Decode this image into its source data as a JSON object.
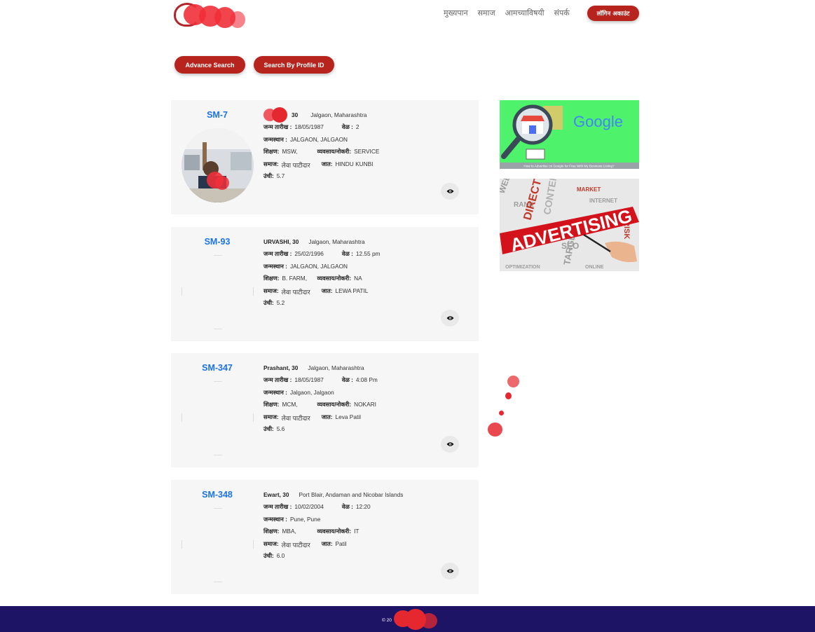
{
  "header": {
    "nav": [
      "मुख्यपान",
      "समाज",
      "आमच्याविषयी",
      "संपर्क"
    ],
    "login_label": "लॉगिन अकाउंट"
  },
  "search": {
    "advance_label": "Advance Search",
    "by_id_label": "Search By Profile ID"
  },
  "labels": {
    "dob": "जन्म तारीख :",
    "time": "वेळ :",
    "birthplace": "जन्मस्थान :",
    "education": "शिक्षण:",
    "occupation": "व्यवसाय/नोकरी:",
    "community": "समाज:",
    "caste": "जात:",
    "height": "उंची:"
  },
  "profiles": [
    {
      "id": "SM-7",
      "name_age": "30",
      "location": "Jalgaon, Maharashtra",
      "dob": "18/05/1987",
      "time": "2",
      "birthplace": "JALGAON, JALGAON",
      "education": "MSW,",
      "occupation": "SERVICE",
      "community": "लेवा पाटीदार",
      "caste": "HINDU KUNBI",
      "height": "5.7"
    },
    {
      "id": "SM-93",
      "name_age": "URVASHI, 30",
      "location": "Jalgaon, Maharashtra",
      "dob": "25/02/1996",
      "time": "12.55 pm",
      "birthplace": "JALGAON, JALGAON",
      "education": "B. FARM,",
      "occupation": "NA",
      "community": "लेवा पाटीदार",
      "caste": "LEWA PATIL",
      "height": "5.2"
    },
    {
      "id": "SM-347",
      "name_age": "Prashant, 30",
      "location": "Jalgaon, Maharashtra",
      "dob": "18/05/1987",
      "time": "4:08 Pm",
      "birthplace": "Jalgaon, Jalgaon",
      "education": "MCM,",
      "occupation": "NOKARI",
      "community": "लेवा पाटीदार",
      "caste": "Leva Patil",
      "height": "5.6"
    },
    {
      "id": "SM-348",
      "name_age": "Ewart, 30",
      "location": "Port Blair, Andaman and Nicobar Islands",
      "dob": "10/02/2004",
      "time": "12:20",
      "birthplace": "Pune, Pune",
      "education": "MBA,",
      "occupation": "IT",
      "community": "लेवा पाटीदार",
      "caste": "Patil",
      "height": "6.0"
    }
  ],
  "ads": {
    "ad1_brand": "Google",
    "ad1_caption": "How to Advertise on Google for Free With My Business Listing?",
    "ad2_text": "ADVERTISING",
    "ad2_words": [
      "WEBSITE",
      "RANK",
      "DIRECT",
      "CONTENT",
      "MARKET",
      "INTERNET",
      "TARGET",
      "SEO",
      "RISK",
      "ONLINE",
      "OPTIMIZATION"
    ]
  },
  "footer": {
    "copyright": "© 20"
  },
  "colors": {
    "accent": "#b7241e",
    "link": "#1a73e8",
    "footer_bg": "#1d1466",
    "card_bg": "#f6f6f6"
  }
}
